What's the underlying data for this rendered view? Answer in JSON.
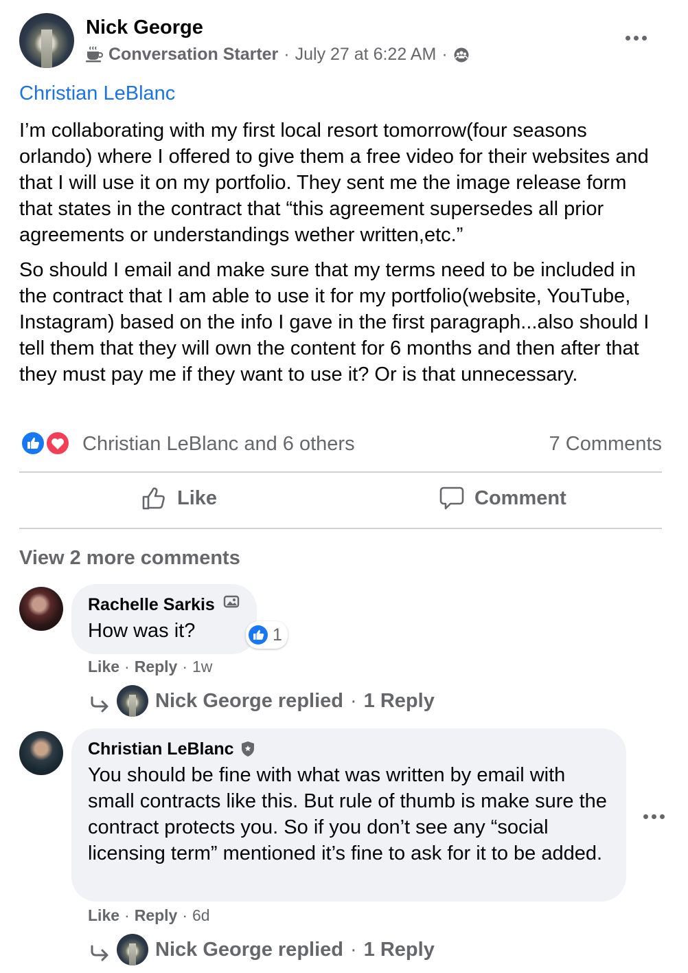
{
  "post": {
    "author": "Nick George",
    "badge": "Conversation Starter",
    "separator1": "·",
    "timestamp": "July 27 at 6:22 AM",
    "separator2": "·",
    "mention": "Christian LeBlanc",
    "paragraphs": [
      "I’m collaborating with my first local resort tomorrow(four seasons orlando) where I offered to give them a free video for their websites and that I will use it on my portfolio. They sent me the image release form that states in the contract that “this agreement supersedes all prior agreements or understandings wether written,etc.”",
      "So should I email and make sure that my terms need to be included in the contract that I am able to use it for my portfolio(website, YouTube, Instagram) based on the info I gave in the first paragraph...also should I tell them that they will own the content for 6 months and then after that they must pay me if they want to use it? Or is that unnecessary."
    ]
  },
  "reactions": {
    "summary": "Christian LeBlanc and 6 others",
    "comments_count": "7 Comments"
  },
  "actions": {
    "like": "Like",
    "comment": "Comment"
  },
  "comments": {
    "view_more": "View 2 more comments",
    "items": [
      {
        "author": "Rachelle Sarkis",
        "text": "How was it?",
        "reaction_count": "1",
        "like": "Like",
        "sep": "·",
        "reply": "Reply",
        "time": "1w",
        "reply_line": {
          "name": "Nick George replied",
          "sep": "·",
          "count": "1 Reply"
        }
      },
      {
        "author": "Christian LeBlanc",
        "text": "You should be fine with what was written by email with small contracts like this. But rule of thumb is make sure the contract protects you. So if you don’t see any “social licensing term” mentioned it’s fine to ask for it to be added.",
        "like": "Like",
        "sep": "·",
        "reply": "Reply",
        "time": "6d",
        "reply_line": {
          "name": "Nick George replied",
          "sep": "·",
          "count": "1 Reply"
        }
      }
    ]
  },
  "colors": {
    "link": "#1b74e4",
    "muted": "#65676b",
    "like_blue": "#1877f2",
    "love_red": "#f33e58",
    "bubble": "#f0f2f5"
  }
}
